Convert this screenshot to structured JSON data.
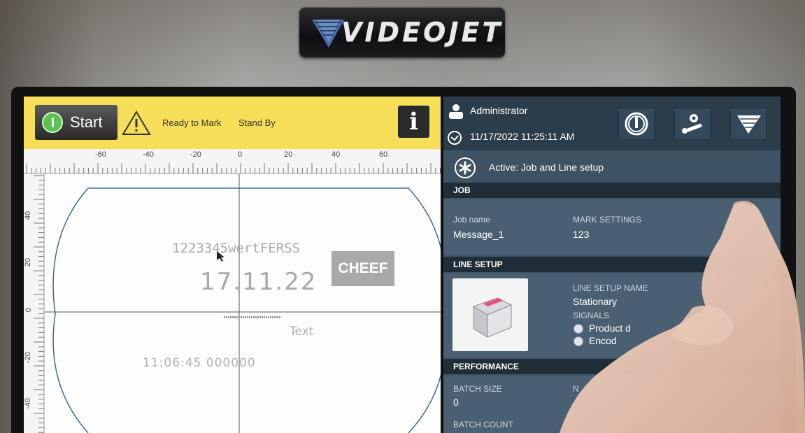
{
  "brand": {
    "logo_text": "VIDEOJET",
    "registered": "®"
  },
  "status_bar": {
    "start_label": "Start",
    "ready_text": "Ready to Mark",
    "standby_text": "Stand By",
    "info_label": "i",
    "colors": {
      "background": "#f6de58",
      "start_green": "#5cc251"
    }
  },
  "ruler": {
    "h_ticks": [
      "-60",
      "-40",
      "-20",
      "0",
      "20",
      "40",
      "60"
    ],
    "v_ticks": [
      "40",
      "20",
      "0",
      "-20",
      "-40"
    ]
  },
  "canvas": {
    "fields": {
      "text1": "1223345wertFERSS",
      "date": "17.11.22",
      "text_label": "Text",
      "time_counter": "11:06:45   000000"
    },
    "watermark": "CHEEF"
  },
  "header": {
    "user": "Administrator",
    "datetime": "11/17/2022 11:25:11 AM",
    "buttons": [
      "power-icon",
      "service-tools-icon",
      "videojet-menu-icon"
    ]
  },
  "active": {
    "text": "Active: Job and Line setup"
  },
  "job": {
    "title": "JOB",
    "job_name_label": "Job name",
    "job_name_value": "Message_1",
    "mark_settings_label": "MARK SETTINGS",
    "mark_settings_value": "123"
  },
  "line_setup": {
    "title": "LINE SETUP",
    "name_label": "LINE SETUP NAME",
    "name_value": "Stationary",
    "signals_label": "SIGNALS",
    "signal_1": "Product d",
    "signal_2": "Encod"
  },
  "performance": {
    "title": "PERFORMANCE",
    "batch_size_label": "BATCH SIZE",
    "batch_size_value": "0",
    "batch_count_label": "BATCH COUNT",
    "partial_label": "N"
  }
}
